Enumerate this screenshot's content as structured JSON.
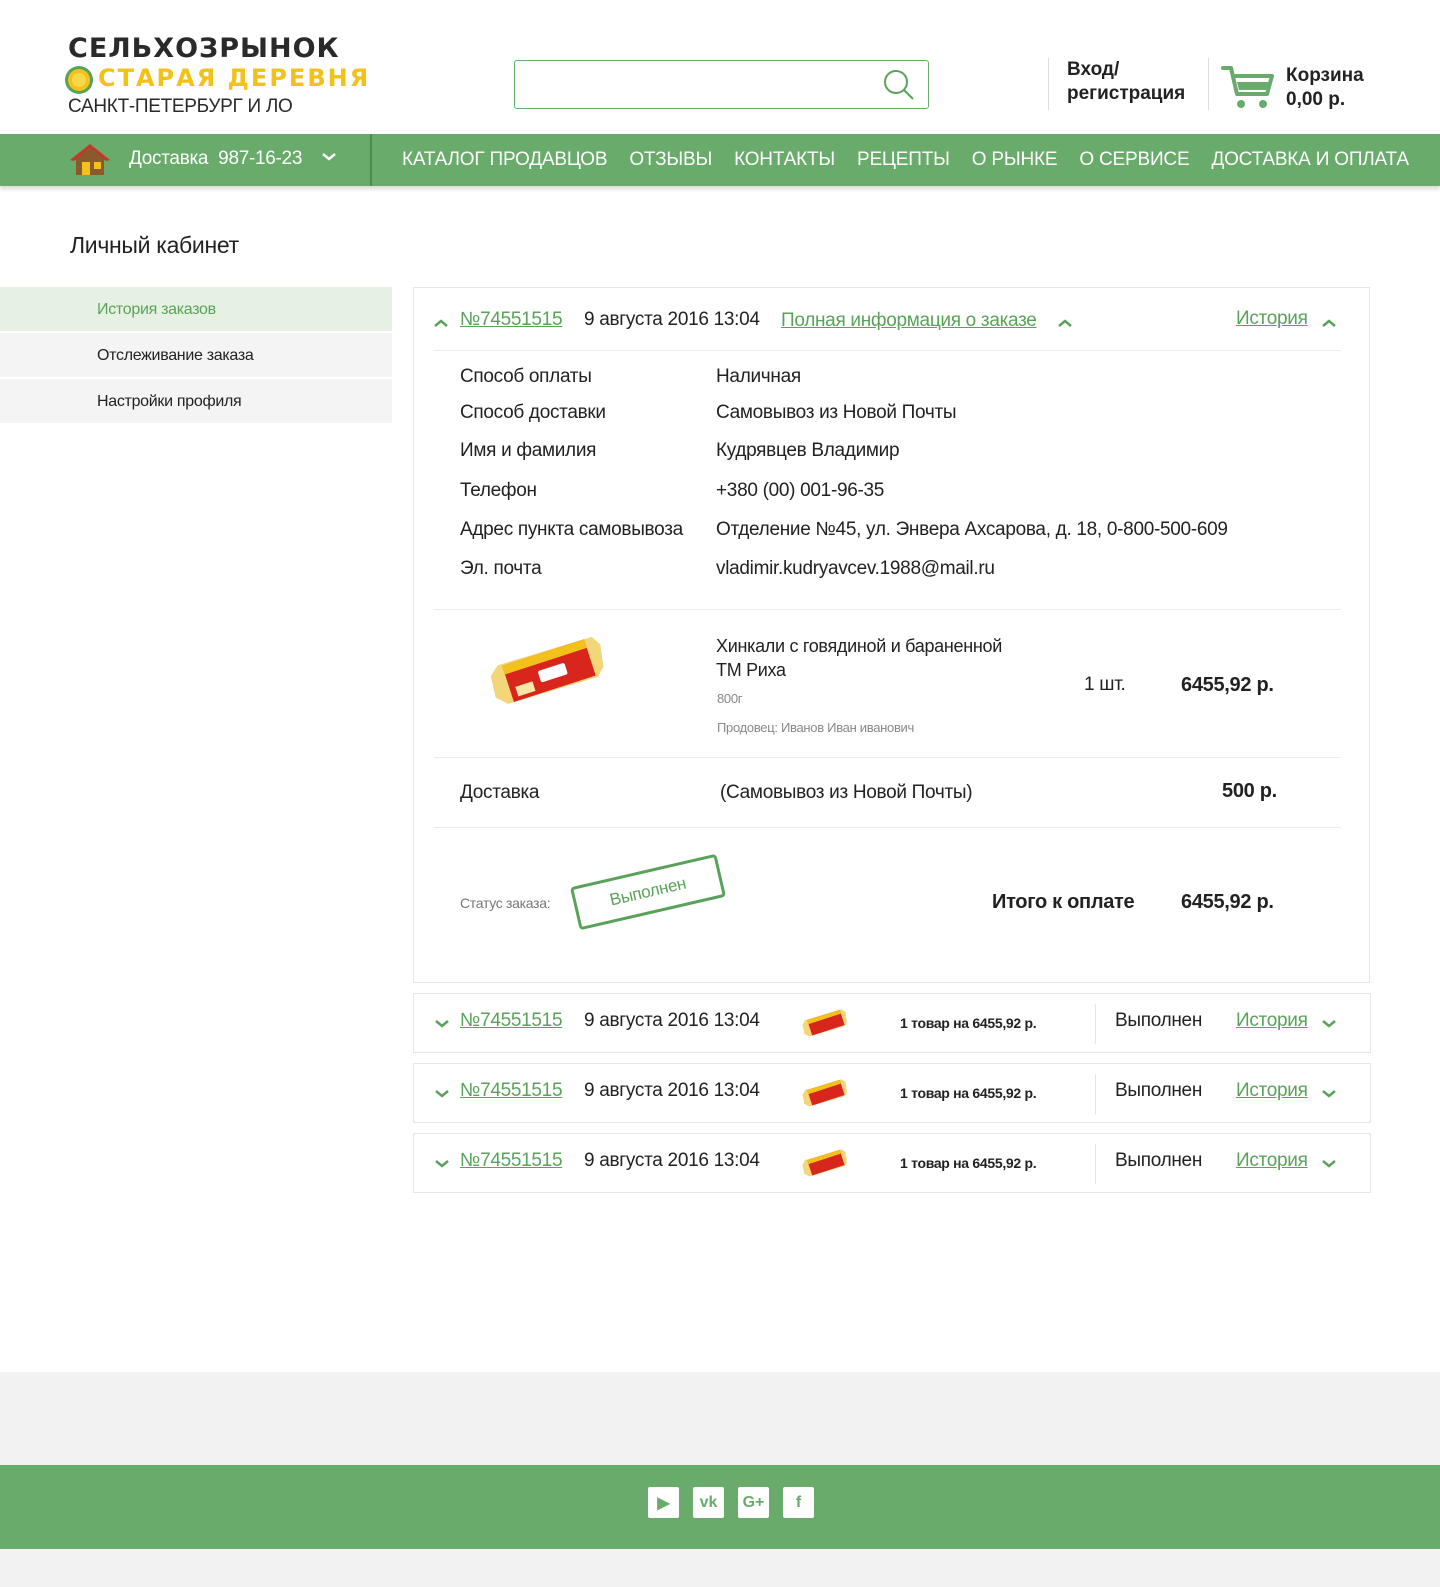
{
  "header": {
    "logo_line1": "СЕЛЬХОЗРЫНОК",
    "logo_line2": "СТАРАЯ ДЕРЕВНЯ",
    "logo_line3": "САНКТ-ПЕТЕРБУРГ И ЛО",
    "search": {
      "value": "",
      "placeholder": ""
    },
    "login_line1": "Вход/",
    "login_line2": "регистрация",
    "cart_label": "Корзина",
    "cart_total": "0,00 р."
  },
  "nav": {
    "delivery_label": "Доставка",
    "delivery_phone": "987-16-23",
    "links": [
      "КАТАЛОГ ПРОДАВЦОВ",
      "ОТЗЫВЫ",
      "КОНТАКТЫ",
      "РЕЦЕПТЫ",
      "О РЫНКЕ",
      "О СЕРВИСЕ",
      "ДОСТАВКА И ОПЛАТА"
    ]
  },
  "page_title": "Личный кабинет",
  "sidebar": {
    "items": [
      {
        "label": "История заказов",
        "active": true
      },
      {
        "label": "Отслеживание заказа",
        "active": false
      },
      {
        "label": "Настройки профиля",
        "active": false
      }
    ]
  },
  "expanded_order": {
    "number": "№74551515",
    "date": "9 августа 2016 13:04",
    "full_info_link": "Полная информация о заказе",
    "history_link": "История",
    "info": [
      {
        "label": "Способ оплаты",
        "value": "Наличная"
      },
      {
        "label": "Способ доставки",
        "value": "Самовывоз из Новой Почты"
      },
      {
        "label": "Имя и фамилия",
        "value": "Кудрявцев Владимир"
      },
      {
        "label": "Телефон",
        "value": "+380 (00) 001-96-35"
      },
      {
        "label": "Адрес пункта самовывоза",
        "value": "Отделение №45, ул. Энвера Ахсарова, д. 18, 0-800-500-609"
      },
      {
        "label": "Эл. почта",
        "value": "vladimir.kudryavcev.1988@mail.ru"
      }
    ],
    "product": {
      "name_line1": "Хинкали с говядиной и бараненной",
      "name_line2": "ТМ Риха",
      "weight": "800г",
      "seller": "Продовец: Иванов Иван иванович",
      "qty": "1 шт.",
      "price": "6455,92 р."
    },
    "delivery": {
      "label": "Доставка",
      "method": "(Самовывоз из Новой Почты)",
      "price": "500 р."
    },
    "status_label": "Статус заказа:",
    "status_stamp": "Выполнен",
    "total_label": "Итого к оплате",
    "total_value": "6455,92 р."
  },
  "orders": [
    {
      "number": "№74551515",
      "date": "9 августа 2016 13:04",
      "summary": "1 товар на 6455,92 р.",
      "status": "Выполнен",
      "history": "История"
    },
    {
      "number": "№74551515",
      "date": "9 августа 2016 13:04",
      "summary": "1 товар на 6455,92 р.",
      "status": "Выполнен",
      "history": "История"
    },
    {
      "number": "№74551515",
      "date": "9 августа 2016 13:04",
      "summary": "1 товар на 6455,92 р.",
      "status": "Выполнен",
      "history": "История"
    }
  ],
  "footer": {
    "social": [
      {
        "name": "youtube-icon",
        "glyph": "▶"
      },
      {
        "name": "vk-icon",
        "glyph": "vk"
      },
      {
        "name": "google-plus-icon",
        "glyph": "G+"
      },
      {
        "name": "facebook-icon",
        "glyph": "f"
      }
    ]
  },
  "colors": {
    "brand_green": "#69ab6a",
    "link_green": "#5aa25a",
    "logo_yellow": "#f2c21a"
  }
}
